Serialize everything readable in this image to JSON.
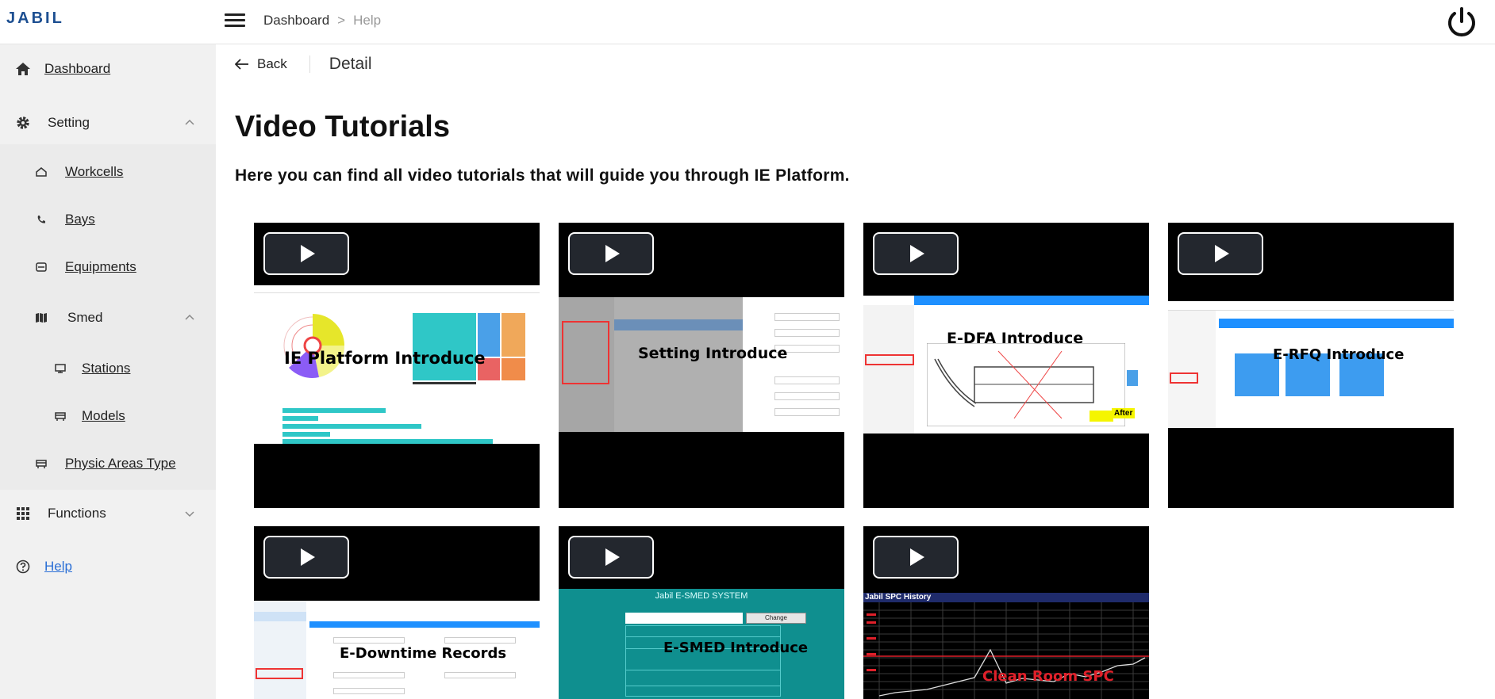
{
  "header": {
    "logo": "JABIL",
    "breadcrumb": {
      "root": "Dashboard",
      "separator": ">",
      "current": "Help"
    }
  },
  "sidebar": {
    "dashboard": "Dashboard",
    "setting": "Setting",
    "workcells": "Workcells",
    "bays": "Bays",
    "equipments": "Equipments",
    "smed": "Smed",
    "stations": "Stations",
    "models": "Models",
    "physic_areas_type": "Physic Areas Type",
    "functions": "Functions",
    "help": "Help"
  },
  "main": {
    "back_label": "Back",
    "detail_title": "Detail",
    "page_title": "Video Tutorials",
    "page_subtitle": "Here you can find all video tutorials that will guide you through IE Platform.",
    "videos": [
      {
        "caption": "IE Platform  Introduce"
      },
      {
        "caption": "Setting Introduce"
      },
      {
        "caption": "E-DFA Introduce"
      },
      {
        "caption": "E-RFQ Introduce"
      },
      {
        "caption": "E-Downtime Records"
      },
      {
        "caption": "E-SMED Introduce",
        "screen_title": "Jabil E-SMED SYSTEM",
        "screen_button": "Change"
      },
      {
        "caption": "Clean Room SPC",
        "screen_title": "Jabil SPC History"
      }
    ]
  },
  "colors": {
    "logo": "#1d4f91",
    "help_link": "#2b6fd6",
    "sidebar_bg": "#f1f1f1",
    "smed_teal": "#0f8f8f",
    "spc_red": "#e0202a"
  }
}
